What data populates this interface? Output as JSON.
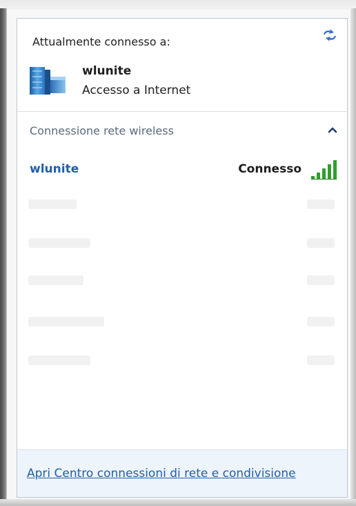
{
  "header": {
    "title": "Attualmente connesso a:",
    "refresh_icon": "refresh-arrows-icon",
    "network_icon": "network-building-icon",
    "connected_network_name": "wlunite",
    "connected_network_status": "Accesso a Internet"
  },
  "section": {
    "title": "Connessione rete wireless",
    "collapse_icon": "chevron-up-icon"
  },
  "networks": [
    {
      "name": "wlunite",
      "state": "Connesso",
      "signal_icon": "signal-strength-icon",
      "signal_bars": 5
    }
  ],
  "footer": {
    "link": "Apri Centro connessioni di rete e condivisione"
  },
  "colors": {
    "link_blue": "#1f5fa8",
    "section_gray": "#5a6a7c",
    "signal_green": "#2f9e2f",
    "footer_bg": "#eef4fb"
  }
}
